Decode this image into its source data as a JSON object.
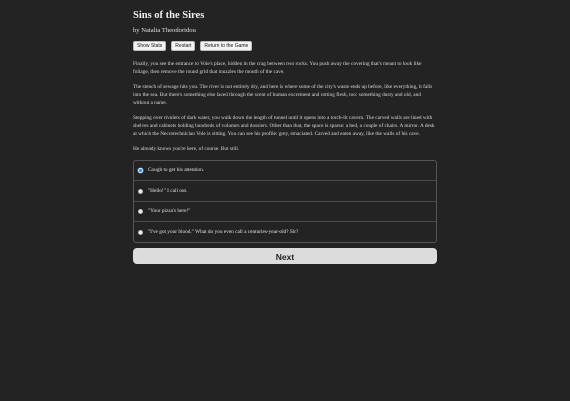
{
  "game": {
    "title": "Sins of the Sires",
    "author": "by Natalia Theodoridou"
  },
  "toolbar": {
    "show_stats": "Show Stats",
    "restart": "Restart",
    "return_to_game": "Return to the Game"
  },
  "story": {
    "paragraphs": [
      "Finally, you see the entrance to Vole's place, hidden in the crag between two rocks. You push away the covering that's meant to look like foliage, then remove the round grid that muzzles the mouth of the cave.",
      "The stench of sewage hits you. The river is not entirely dry, and here is where some of the city's waste ends up before, like everything, it falls into the sea. But there's something else laced through the scent of human excrement and rotting flesh, too: something dusty and old, and without a name.",
      "Stepping over rivulets of dark water, you walk down the length of tunnel until it opens into a torch-lit cavern. The carved walls are lined with shelves and cabinets holding hundreds of volumes and dossiers. Other than that, the space is sparse: a bed, a couple of chairs. A mirror. A desk at which the Necrotechnician Vole is sitting. You can see his profile: grey, emaciated. Carved and eaten away, like the walls of his cave.",
      "He already knows you're here, of course. But still."
    ]
  },
  "choices": [
    {
      "label": "Cough to get his attention.",
      "selected": true
    },
    {
      "label": "\"Hello!\" I call out.",
      "selected": false
    },
    {
      "label": "\"Your pizza's here!\"",
      "selected": false
    },
    {
      "label": "\"I've got your blood.\" What do you even call a centuries-year-old? Sir?",
      "selected": false
    }
  ],
  "next_label": "Next",
  "colors": {
    "background": "#232323",
    "radio_selected": "#2f7de1",
    "button_bg": "#dcdcdc"
  }
}
